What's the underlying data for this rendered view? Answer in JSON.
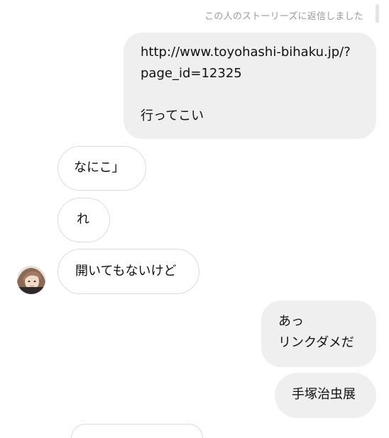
{
  "thread": {
    "story_reply_note": "この人のストーリーズに返信しました",
    "messages": [
      {
        "sender": "me",
        "text": "http://www.toyohashi-bihaku.jp/?\npage_id=12325\n\n行ってこい"
      },
      {
        "sender": "them",
        "text": "なにこ」"
      },
      {
        "sender": "them",
        "text": "れ"
      },
      {
        "sender": "them",
        "text": "開いてもないけど"
      },
      {
        "sender": "me",
        "text": "あっ\nリンクダメだ"
      },
      {
        "sender": "me",
        "text": "手塚治虫展"
      }
    ]
  },
  "colors": {
    "sent_bubble": "#efefef",
    "received_border": "#dbdbdb",
    "meta_text": "#9a9a9a"
  },
  "icons": {
    "avatar": "contact-avatar-icon"
  }
}
